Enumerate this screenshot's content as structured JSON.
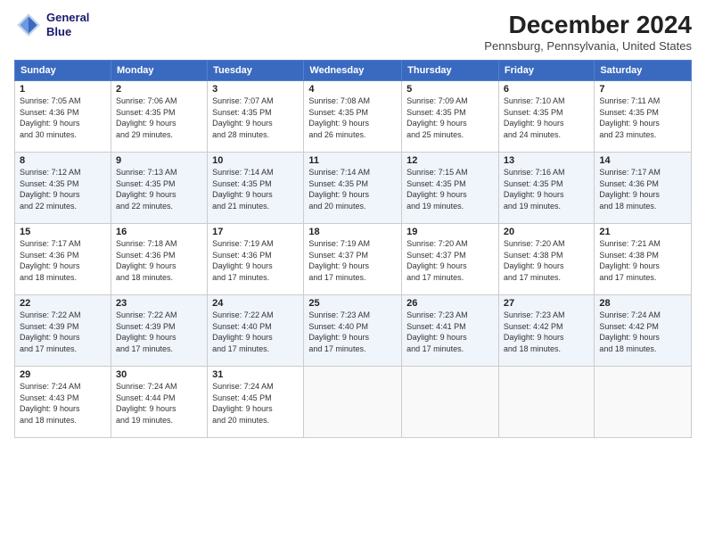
{
  "logo": {
    "line1": "General",
    "line2": "Blue"
  },
  "title": "December 2024",
  "subtitle": "Pennsburg, Pennsylvania, United States",
  "headers": [
    "Sunday",
    "Monday",
    "Tuesday",
    "Wednesday",
    "Thursday",
    "Friday",
    "Saturday"
  ],
  "weeks": [
    [
      {
        "day": "1",
        "info": "Sunrise: 7:05 AM\nSunset: 4:36 PM\nDaylight: 9 hours\nand 30 minutes."
      },
      {
        "day": "2",
        "info": "Sunrise: 7:06 AM\nSunset: 4:35 PM\nDaylight: 9 hours\nand 29 minutes."
      },
      {
        "day": "3",
        "info": "Sunrise: 7:07 AM\nSunset: 4:35 PM\nDaylight: 9 hours\nand 28 minutes."
      },
      {
        "day": "4",
        "info": "Sunrise: 7:08 AM\nSunset: 4:35 PM\nDaylight: 9 hours\nand 26 minutes."
      },
      {
        "day": "5",
        "info": "Sunrise: 7:09 AM\nSunset: 4:35 PM\nDaylight: 9 hours\nand 25 minutes."
      },
      {
        "day": "6",
        "info": "Sunrise: 7:10 AM\nSunset: 4:35 PM\nDaylight: 9 hours\nand 24 minutes."
      },
      {
        "day": "7",
        "info": "Sunrise: 7:11 AM\nSunset: 4:35 PM\nDaylight: 9 hours\nand 23 minutes."
      }
    ],
    [
      {
        "day": "8",
        "info": "Sunrise: 7:12 AM\nSunset: 4:35 PM\nDaylight: 9 hours\nand 22 minutes."
      },
      {
        "day": "9",
        "info": "Sunrise: 7:13 AM\nSunset: 4:35 PM\nDaylight: 9 hours\nand 22 minutes."
      },
      {
        "day": "10",
        "info": "Sunrise: 7:14 AM\nSunset: 4:35 PM\nDaylight: 9 hours\nand 21 minutes."
      },
      {
        "day": "11",
        "info": "Sunrise: 7:14 AM\nSunset: 4:35 PM\nDaylight: 9 hours\nand 20 minutes."
      },
      {
        "day": "12",
        "info": "Sunrise: 7:15 AM\nSunset: 4:35 PM\nDaylight: 9 hours\nand 19 minutes."
      },
      {
        "day": "13",
        "info": "Sunrise: 7:16 AM\nSunset: 4:35 PM\nDaylight: 9 hours\nand 19 minutes."
      },
      {
        "day": "14",
        "info": "Sunrise: 7:17 AM\nSunset: 4:36 PM\nDaylight: 9 hours\nand 18 minutes."
      }
    ],
    [
      {
        "day": "15",
        "info": "Sunrise: 7:17 AM\nSunset: 4:36 PM\nDaylight: 9 hours\nand 18 minutes."
      },
      {
        "day": "16",
        "info": "Sunrise: 7:18 AM\nSunset: 4:36 PM\nDaylight: 9 hours\nand 18 minutes."
      },
      {
        "day": "17",
        "info": "Sunrise: 7:19 AM\nSunset: 4:36 PM\nDaylight: 9 hours\nand 17 minutes."
      },
      {
        "day": "18",
        "info": "Sunrise: 7:19 AM\nSunset: 4:37 PM\nDaylight: 9 hours\nand 17 minutes."
      },
      {
        "day": "19",
        "info": "Sunrise: 7:20 AM\nSunset: 4:37 PM\nDaylight: 9 hours\nand 17 minutes."
      },
      {
        "day": "20",
        "info": "Sunrise: 7:20 AM\nSunset: 4:38 PM\nDaylight: 9 hours\nand 17 minutes."
      },
      {
        "day": "21",
        "info": "Sunrise: 7:21 AM\nSunset: 4:38 PM\nDaylight: 9 hours\nand 17 minutes."
      }
    ],
    [
      {
        "day": "22",
        "info": "Sunrise: 7:22 AM\nSunset: 4:39 PM\nDaylight: 9 hours\nand 17 minutes."
      },
      {
        "day": "23",
        "info": "Sunrise: 7:22 AM\nSunset: 4:39 PM\nDaylight: 9 hours\nand 17 minutes."
      },
      {
        "day": "24",
        "info": "Sunrise: 7:22 AM\nSunset: 4:40 PM\nDaylight: 9 hours\nand 17 minutes."
      },
      {
        "day": "25",
        "info": "Sunrise: 7:23 AM\nSunset: 4:40 PM\nDaylight: 9 hours\nand 17 minutes."
      },
      {
        "day": "26",
        "info": "Sunrise: 7:23 AM\nSunset: 4:41 PM\nDaylight: 9 hours\nand 17 minutes."
      },
      {
        "day": "27",
        "info": "Sunrise: 7:23 AM\nSunset: 4:42 PM\nDaylight: 9 hours\nand 18 minutes."
      },
      {
        "day": "28",
        "info": "Sunrise: 7:24 AM\nSunset: 4:42 PM\nDaylight: 9 hours\nand 18 minutes."
      }
    ],
    [
      {
        "day": "29",
        "info": "Sunrise: 7:24 AM\nSunset: 4:43 PM\nDaylight: 9 hours\nand 18 minutes."
      },
      {
        "day": "30",
        "info": "Sunrise: 7:24 AM\nSunset: 4:44 PM\nDaylight: 9 hours\nand 19 minutes."
      },
      {
        "day": "31",
        "info": "Sunrise: 7:24 AM\nSunset: 4:45 PM\nDaylight: 9 hours\nand 20 minutes."
      },
      null,
      null,
      null,
      null
    ]
  ]
}
